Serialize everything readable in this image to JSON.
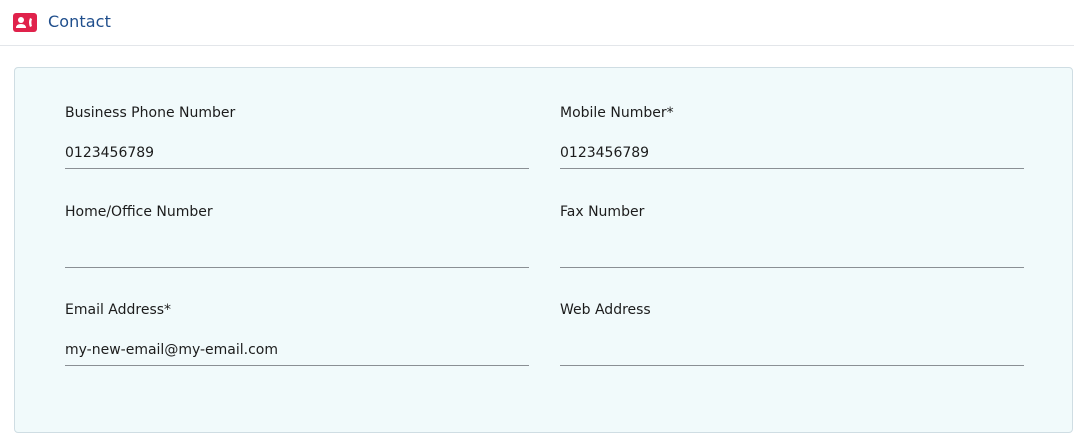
{
  "header": {
    "title": "Contact",
    "icon": "contact-card-icon",
    "accent_color": "#e0224b",
    "title_color": "#1f4e8c"
  },
  "form": {
    "business_phone": {
      "label": "Business Phone Number",
      "value": "0123456789"
    },
    "mobile": {
      "label": "Mobile Number*",
      "value": "0123456789"
    },
    "home_office": {
      "label": "Home/Office Number",
      "value": ""
    },
    "fax": {
      "label": "Fax Number",
      "value": ""
    },
    "email": {
      "label": "Email Address*",
      "value": "my-new-email@my-email.com"
    },
    "web": {
      "label": "Web Address",
      "value": ""
    }
  }
}
